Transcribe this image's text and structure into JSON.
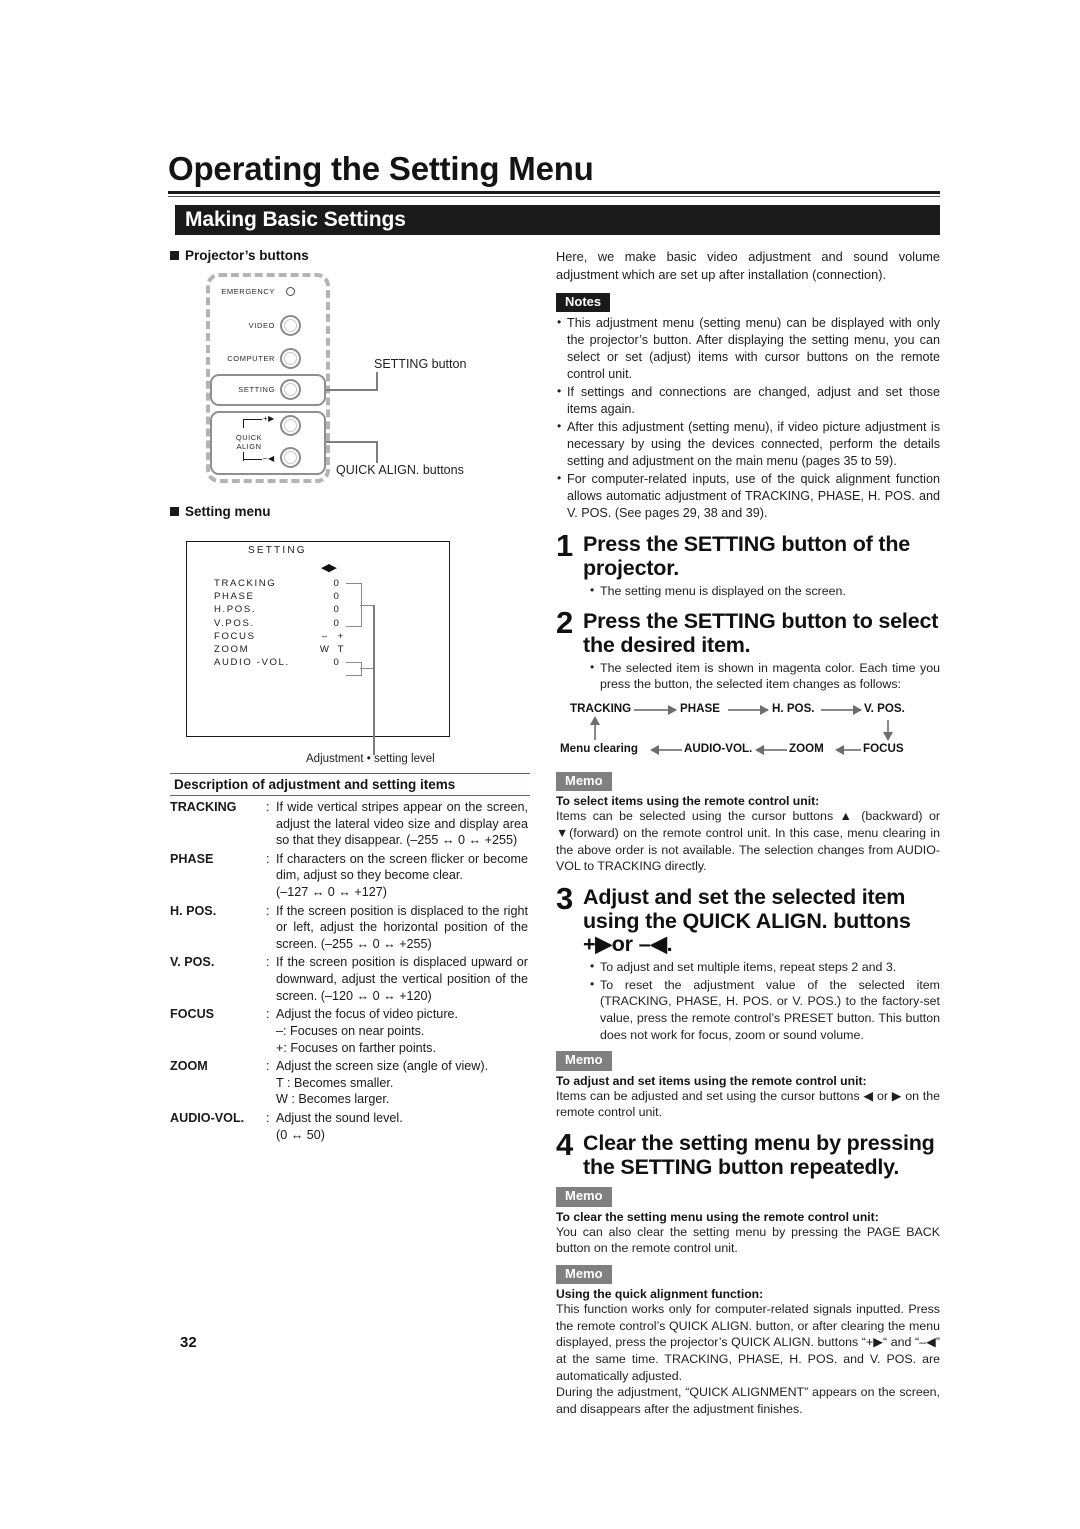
{
  "document": {
    "title": "Operating the Setting Menu",
    "section_bar": "Making Basic Settings",
    "page_number": "32"
  },
  "left_column": {
    "projector_buttons_heading": "Projector’s buttons",
    "projector_figure": {
      "buttons": [
        {
          "label": "EMERGENCY",
          "type": "led"
        },
        {
          "label": "VIDEO",
          "type": "knob"
        },
        {
          "label": "COMPUTER",
          "type": "knob"
        },
        {
          "label": "SETTING",
          "type": "knob"
        }
      ],
      "quick_align_label_line1": "QUICK",
      "quick_align_label_line2": "ALIGN",
      "quick_align_plus": "+",
      "quick_align_minus": "–",
      "callouts": [
        "SETTING button",
        "QUICK ALIGN. buttons"
      ]
    },
    "setting_menu_heading": "Setting menu",
    "osd": {
      "title": "SETTING",
      "cursor": "◀▶",
      "rows": [
        {
          "name": "TRACKING",
          "value": "0"
        },
        {
          "name": "PHASE",
          "value": "0"
        },
        {
          "name": "H.POS.",
          "value": "0"
        },
        {
          "name": "V.POS.",
          "value": "0"
        },
        {
          "name": "FOCUS",
          "value_left": "–",
          "value_right": "+"
        },
        {
          "name": "ZOOM",
          "value_left": "W",
          "value_right": "T"
        },
        {
          "name": "AUDIO -VOL.",
          "value": "0"
        }
      ],
      "caption": "Adjustment • setting level"
    },
    "description": {
      "heading": "Description of adjustment and setting items",
      "items": [
        {
          "term": "TRACKING",
          "text": "If wide vertical stripes appear on the screen, adjust the lateral video size and display area so that they disappear. (–255 ↔ 0 ↔ +255)"
        },
        {
          "term": "PHASE",
          "text": "If characters on the screen flicker or become dim, adjust so they become clear.",
          "extra": [
            "(–127 ↔ 0 ↔ +127)"
          ]
        },
        {
          "term": "H. POS.",
          "text": "If the screen position is displaced to the right or left, adjust the horizontal position of the screen. (–255 ↔ 0 ↔ +255)"
        },
        {
          "term": "V. POS.",
          "text": "If the screen position is displaced upward or downward, adjust the vertical position of the screen. (–120 ↔ 0 ↔ +120)"
        },
        {
          "term": "FOCUS",
          "text": "Adjust the focus of video picture.",
          "extra": [
            "–: Focuses on near points.",
            "+: Focuses on farther points."
          ]
        },
        {
          "term": "ZOOM",
          "text": "Adjust the screen size (angle of view).",
          "extra": [
            "T : Becomes smaller.",
            "W : Becomes larger."
          ]
        },
        {
          "term": "AUDIO-VOL.",
          "text": "Adjust the sound level.",
          "extra": [
            "(0 ↔ 50)"
          ]
        }
      ]
    }
  },
  "right_column": {
    "intro": "Here, we make basic video adjustment and sound volume adjustment which are set up after installation (connection).",
    "notes_badge": "Notes",
    "notes": [
      "This adjustment menu (setting menu) can be displayed with only the projector’s button. After displaying the setting menu, you can select or set (adjust) items with cursor buttons on the remote control unit.",
      "If settings and connections are changed, adjust and set those items again.",
      "After this adjustment (setting menu), if video picture adjustment is necessary by using the devices connected, perform the details setting and adjustment on the main menu (pages 35 to 59).",
      "For computer-related inputs, use of the quick alignment function allows automatic adjustment of TRACKING, PHASE, H. POS. and V. POS. (See pages 29, 38 and 39)."
    ],
    "steps": [
      {
        "num": "1",
        "text": "Press the SETTING button of the projector.",
        "bullets": [
          "The setting menu is displayed on the screen."
        ]
      },
      {
        "num": "2",
        "text": "Press the SETTING button to select the desired item.",
        "bullets": [
          "The selected item is shown in magenta color. Each time you press the button, the selected item changes as follows:"
        ]
      },
      {
        "num": "3",
        "text": "Adjust and set the selected item using the QUICK ALIGN. buttons +▶or –◀.",
        "bullets": [
          "To adjust and set multiple items, repeat steps 2 and 3.",
          "To reset the adjustment value of the selected item (TRACKING, PHASE, H. POS. or V. POS.) to the factory-set value, press the remote control’s PRESET button. This button does not work for focus, zoom or sound volume."
        ]
      },
      {
        "num": "4",
        "text": "Clear the setting menu by pressing the SETTING button repeatedly.",
        "bullets": []
      }
    ],
    "flow": {
      "top": [
        "TRACKING",
        "PHASE",
        "H. POS.",
        "V. POS."
      ],
      "bottom": [
        "Menu clearing",
        "AUDIO-VOL.",
        "ZOOM",
        "FOCUS"
      ]
    },
    "memos": [
      {
        "badge": "Memo",
        "title": "To select items using the remote control unit:",
        "body": "Items can be selected using the cursor buttons ▲ (backward) or ▼(forward) on the remote control unit. In this case, menu clearing in the above order is not available. The selection changes from AUDIO-VOL to TRACKING directly."
      },
      {
        "badge": "Memo",
        "title": "To adjust and set items using the remote control unit:",
        "body": "Items can be adjusted and set using the cursor buttons ◀ or ▶ on the remote control unit."
      },
      {
        "badge": "Memo",
        "title": "To clear the setting menu using the remote control unit:",
        "body": "You can also clear the setting menu by pressing the PAGE BACK button on the remote control unit."
      },
      {
        "badge": "Memo",
        "title": "Using the quick alignment function:",
        "body": "This function works only for computer-related signals inputted. Press the remote control’s QUICK ALIGN. button, or after clearing the menu displayed, press the projector’s QUICK ALIGN. buttons “+▶“ and “–◀” at the same time. TRACKING, PHASE, H. POS. and V. POS. are automatically adjusted.",
        "body2": "During the adjustment, “QUICK ALIGNMENT” appears on the screen, and disappears after the adjustment finishes."
      }
    ]
  },
  "colors": {
    "ink": "#1a1a1a",
    "notes_badge_bg": "#1a1a1a",
    "memo_badge_bg": "#808080",
    "rule": "#7a5a4a",
    "figure_gray": "#8a8a8a",
    "dash_gray": "#b4b4b4"
  }
}
